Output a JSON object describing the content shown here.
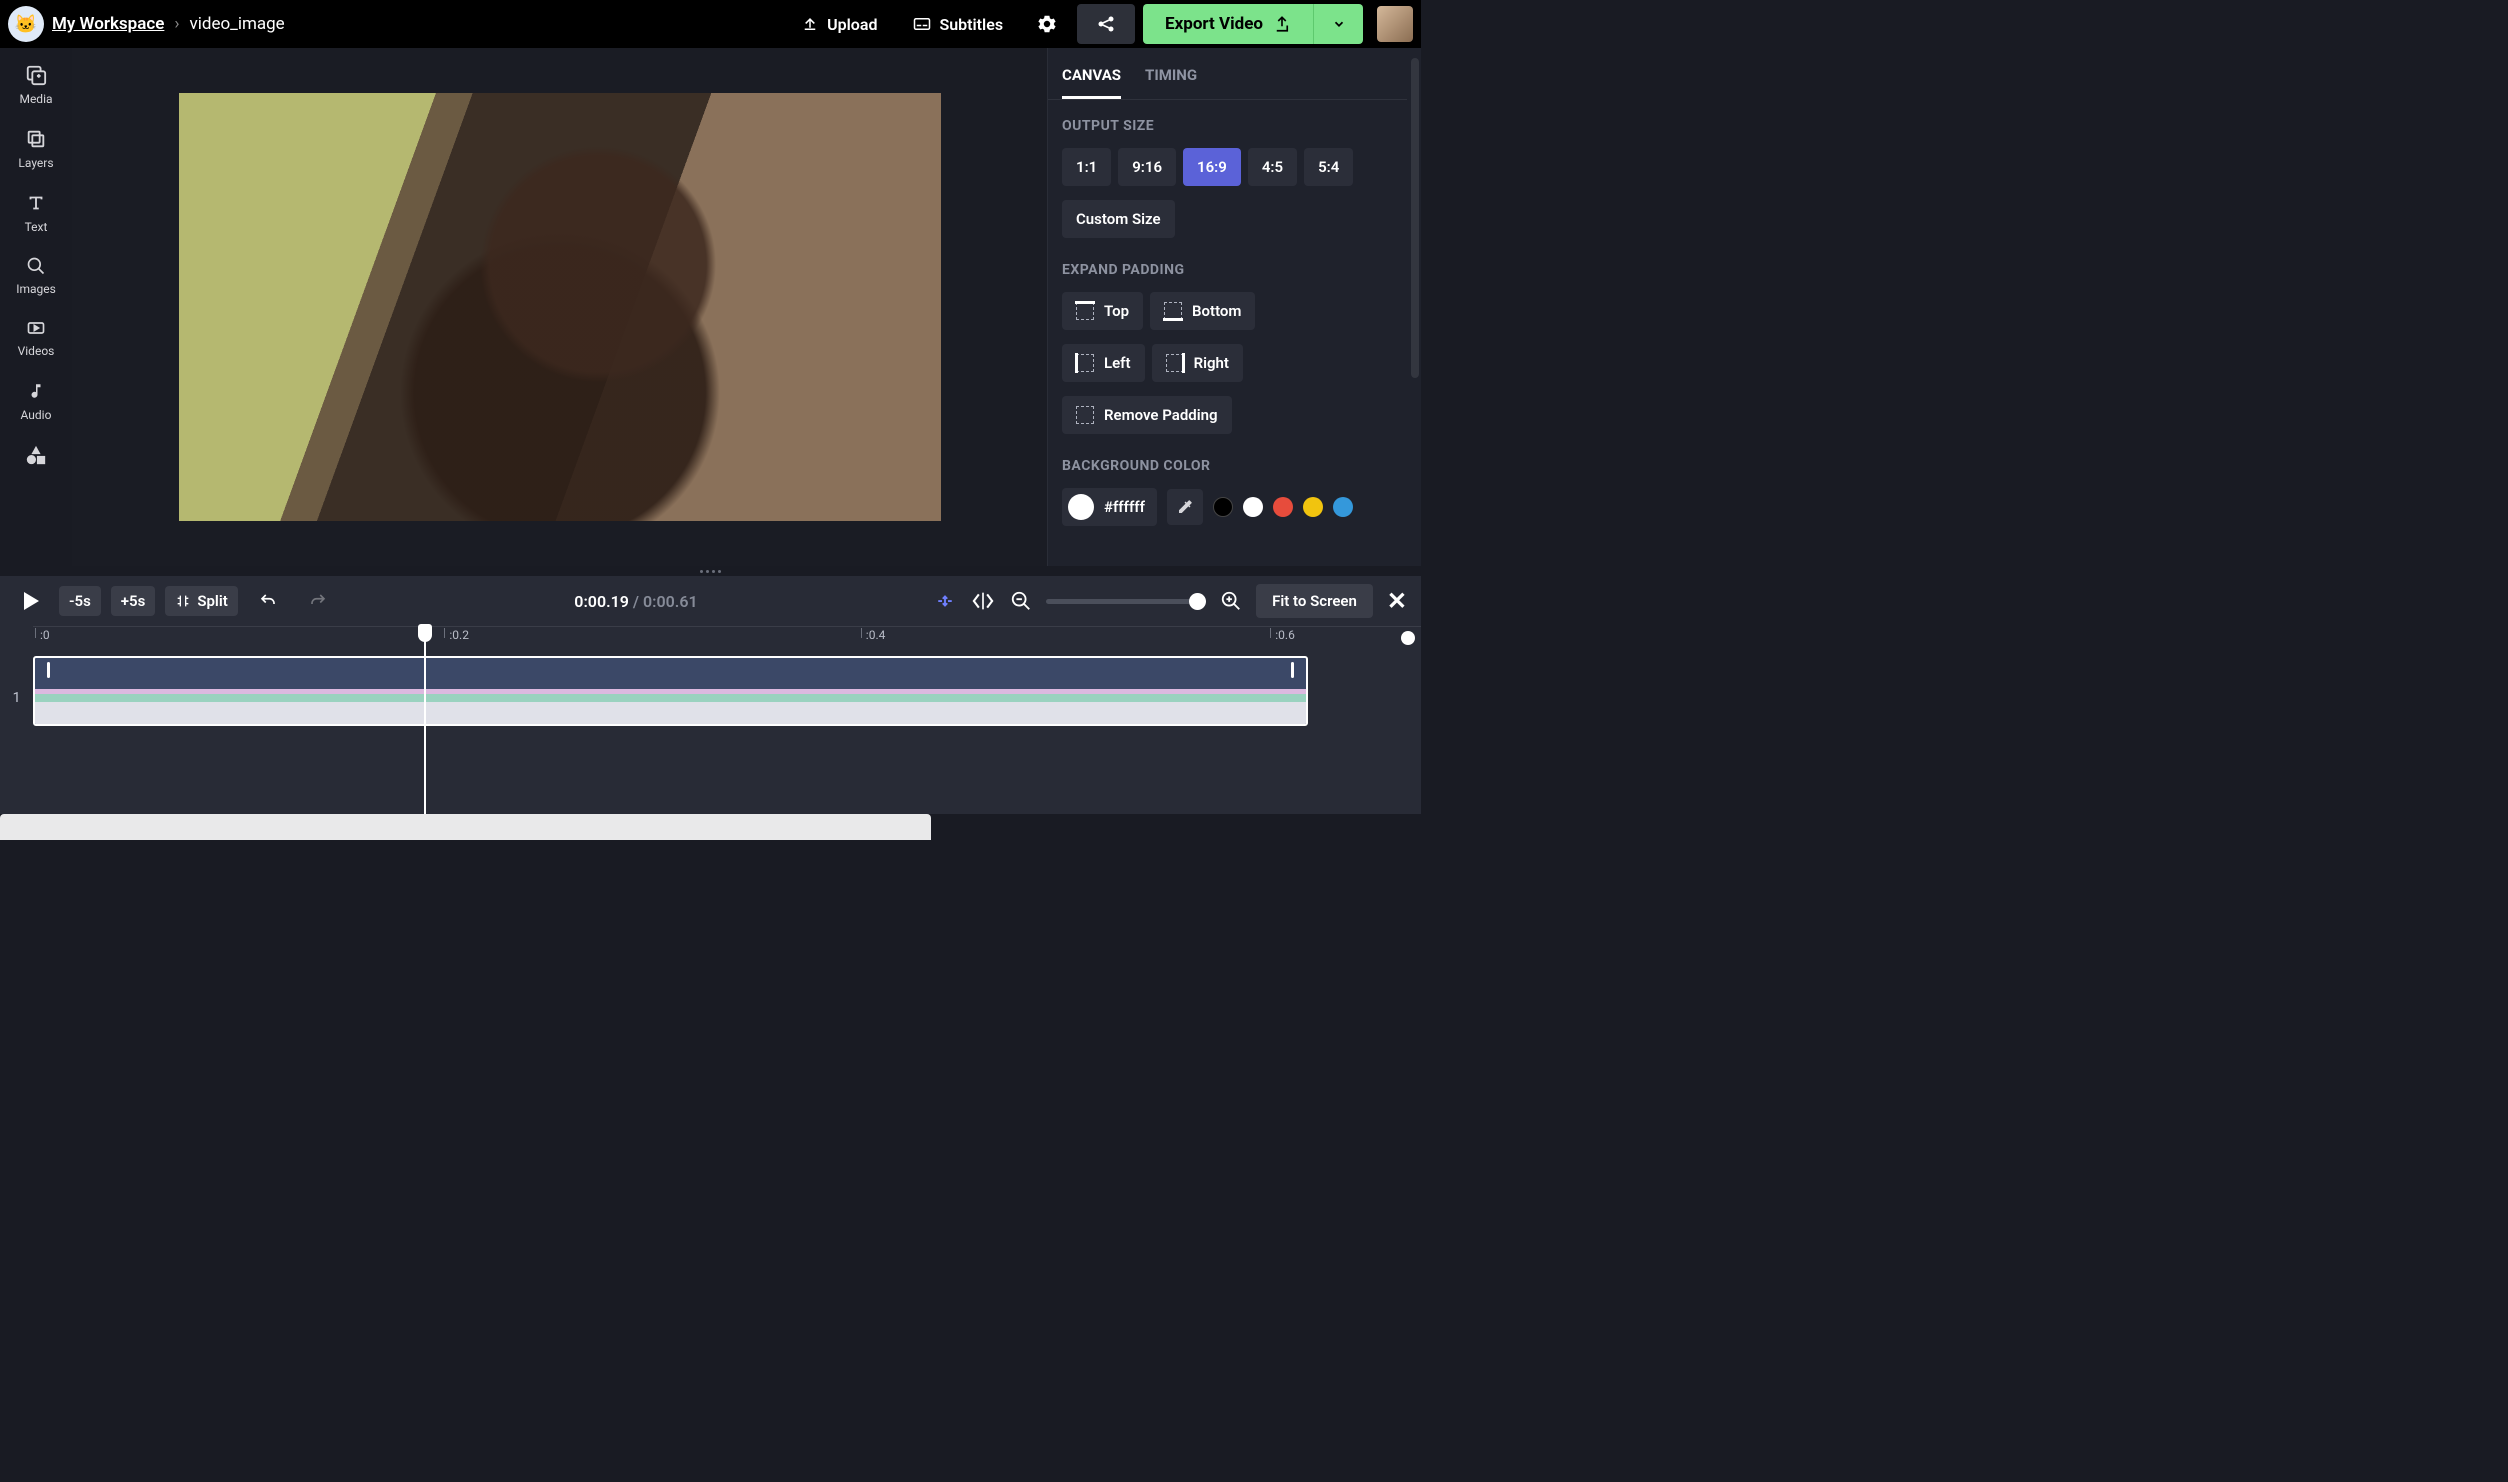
{
  "header": {
    "workspace": "My Workspace",
    "project": "video_image",
    "upload": "Upload",
    "subtitles": "Subtitles",
    "export": "Export Video"
  },
  "sidebar": {
    "items": [
      {
        "label": "Media"
      },
      {
        "label": "Layers"
      },
      {
        "label": "Text"
      },
      {
        "label": "Images"
      },
      {
        "label": "Videos"
      },
      {
        "label": "Audio"
      }
    ]
  },
  "right_panel": {
    "tabs": [
      {
        "label": "CANVAS",
        "active": true
      },
      {
        "label": "TIMING",
        "active": false
      }
    ],
    "output_size": {
      "title": "OUTPUT SIZE",
      "ratios": [
        "1:1",
        "9:16",
        "16:9",
        "4:5",
        "5:4"
      ],
      "active": "16:9",
      "custom": "Custom Size"
    },
    "expand_padding": {
      "title": "EXPAND PADDING",
      "buttons": [
        "Top",
        "Bottom",
        "Left",
        "Right",
        "Remove Padding"
      ]
    },
    "background": {
      "title": "BACKGROUND COLOR",
      "value": "#ffffff",
      "swatches": [
        "#000000",
        "#ffffff",
        "#e74c3c",
        "#f1c40f",
        "#3498db"
      ]
    }
  },
  "transport": {
    "back5": "-5s",
    "fwd5": "+5s",
    "split": "Split",
    "current": "0:00.19",
    "sep": "/",
    "duration": "0:00.61",
    "fit": "Fit to Screen"
  },
  "timeline": {
    "ticks": [
      ":0",
      ":0.2",
      ":0.4",
      ":0.6"
    ],
    "tick_positions": [
      0,
      29.6,
      59.2,
      88.8
    ],
    "track_number": "1",
    "playhead_pos_pct": 28.0
  }
}
